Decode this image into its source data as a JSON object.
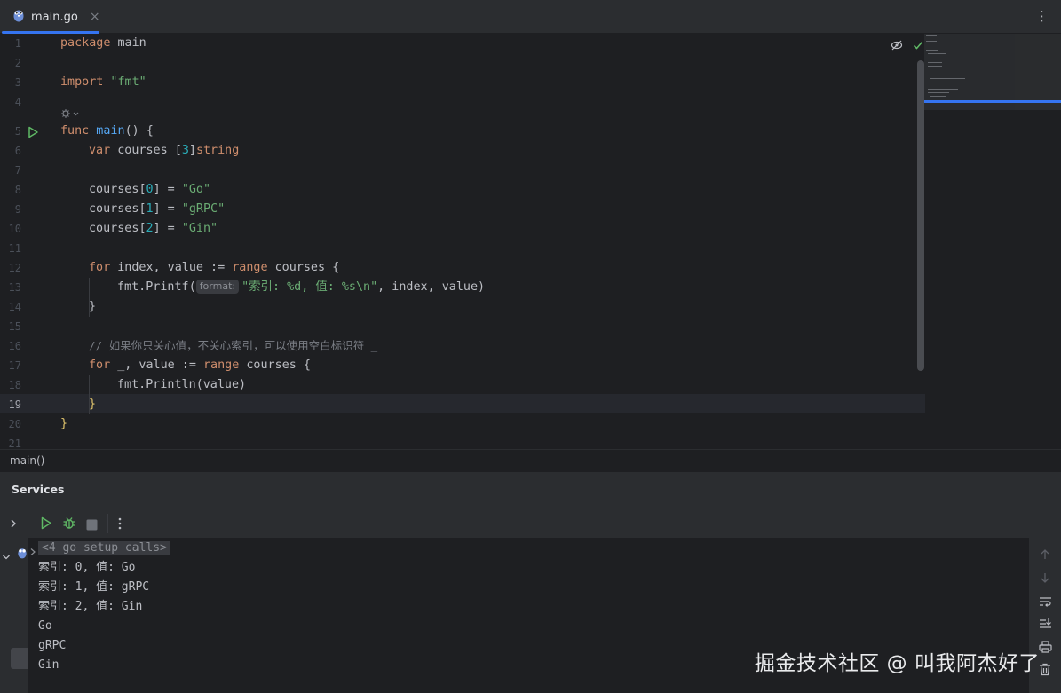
{
  "tab": {
    "title": "main.go",
    "close": "×",
    "more": "⋮"
  },
  "editor": {
    "line_numbers": [
      "1",
      "2",
      "3",
      "4",
      "5",
      "6",
      "7",
      "8",
      "9",
      "10",
      "11",
      "12",
      "13",
      "14",
      "15",
      "16",
      "17",
      "18",
      "19",
      "20",
      "21"
    ],
    "current_line": "19",
    "code": {
      "l1_kw": "package",
      "l1_name": " main",
      "l3_kw": "import",
      "l3_str": " \"fmt\"",
      "l5_kw": "func",
      "l5_fn": " main",
      "l5_rest": "() {",
      "l6_kw": "var",
      "l6_id": " courses ",
      "l6_b1": "[",
      "l6_num": "3",
      "l6_b2": "]",
      "l6_ty": "string",
      "l8_id": "courses",
      "l8_b1": "[",
      "l8_num": "0",
      "l8_b2": "]",
      "l8_eq": " = ",
      "l8_str": "\"Go\"",
      "l9_id": "courses",
      "l9_b1": "[",
      "l9_num": "1",
      "l9_b2": "]",
      "l9_eq": " = ",
      "l9_str": "\"gRPC\"",
      "l10_id": "courses",
      "l10_b1": "[",
      "l10_num": "2",
      "l10_b2": "]",
      "l10_eq": " = ",
      "l10_str": "\"Gin\"",
      "l12_kw": "for",
      "l12_mid": " index, value := ",
      "l12_kw2": "range",
      "l12_end": " courses {",
      "l13_a": "fmt.",
      "l13_fn": "Printf",
      "l13_p": "(",
      "l13_hint": "format:",
      "l13_str": "\"索引: %d, 值: %s\\n\"",
      "l13_end": ", index, value)",
      "l14": "}",
      "l16_cm": "// 如果你只关心值，不关心索引，可以使用空白标识符 _",
      "l17_kw": "for",
      "l17_mid": " _, value := ",
      "l17_kw2": "range",
      "l17_end": " courses {",
      "l18_a": "fmt.",
      "l18_fn": "Println",
      "l18_end": "(value)",
      "l19": "}",
      "l20": "}"
    }
  },
  "breadcrumb": {
    "text": "main()"
  },
  "services": {
    "title": "Services",
    "console_lines": [
      "<4 go setup calls>",
      "索引: 0, 值: Go",
      "索引: 1, 值: gRPC",
      "索引: 2, 值: Gin",
      "Go",
      "gRPC",
      "Gin"
    ]
  },
  "watermark": "掘金技术社区 @ 叫我阿杰好了",
  "colors": {
    "accent": "#3574f0",
    "run": "#5fb865",
    "keyword": "#cf8e6d",
    "string": "#6aab73",
    "function": "#56a8f5",
    "number": "#2aacb8"
  },
  "icons": [
    "gopher-icon",
    "close-icon",
    "more-vertical-icon",
    "run-gutter-icon",
    "reader-mode-icon",
    "check-icon",
    "inlay-settings-icon",
    "expand-icon",
    "run-icon",
    "debug-icon",
    "stop-icon",
    "scroll-up-icon",
    "scroll-down-icon",
    "soft-wrap-icon",
    "scroll-to-end-icon",
    "print-icon",
    "trash-icon"
  ]
}
